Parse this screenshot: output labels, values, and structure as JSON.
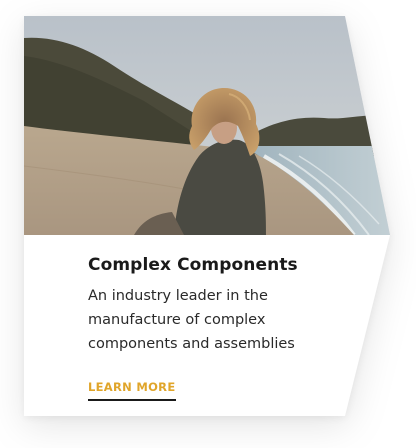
{
  "card": {
    "title": "Complex Components",
    "description_lines": [
      "An industry leader in the",
      "manufacture of complex",
      "components and assemblies"
    ],
    "cta_label": "LEARN MORE",
    "image_subject": "woman-on-beach-photo"
  },
  "colors": {
    "accent": "#e0a52a",
    "title": "#1a1a1a",
    "text": "#2a2a2a",
    "underline": "#1a1a1a"
  }
}
